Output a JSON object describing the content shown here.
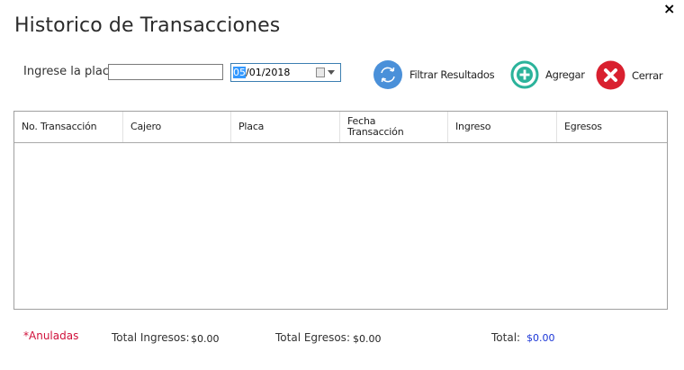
{
  "window": {
    "title": "Historico de Transacciones",
    "close_glyph": "×"
  },
  "filter": {
    "plate_label": "Ingrese la placa:",
    "plate_value": "",
    "date_selected_part": "05",
    "date_rest": "/01/2018"
  },
  "toolbar": {
    "filter_label": "Filtrar Resultados",
    "add_label": "Agregar",
    "close_label": "Cerrar"
  },
  "table": {
    "columns": [
      "No. Transacción",
      "Cajero",
      "Placa",
      "Fecha Transacción",
      "Ingreso",
      "Egresos"
    ],
    "rows": []
  },
  "footer": {
    "anuladas": "*Anuladas",
    "total_ingresos_label": "Total Ingresos:",
    "total_ingresos_value": "$0.00",
    "total_egresos_label": "Total Egresos:",
    "total_egresos_value": "$0.00",
    "total_label": "Total:",
    "total_value": "$0.00"
  },
  "colors": {
    "filter_icon": "#4a90d9",
    "add_icon": "#2bb39b",
    "close_icon": "#d9202f",
    "anuladas": "#d0103a",
    "total_value": "#1a35d6"
  }
}
